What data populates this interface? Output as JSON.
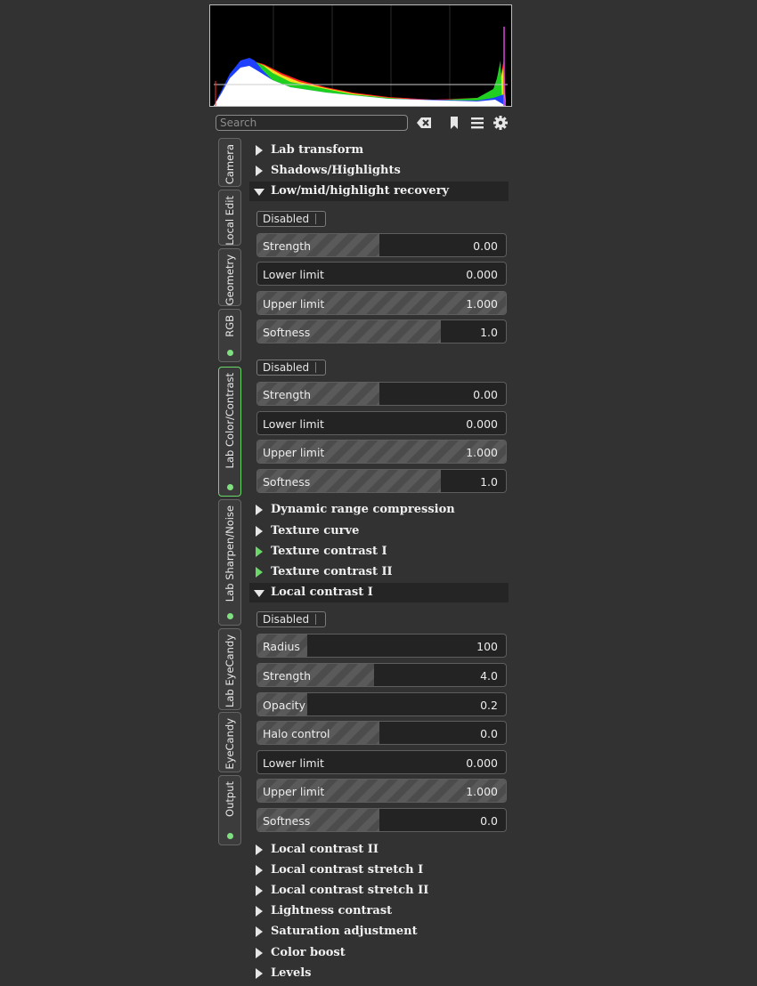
{
  "search": {
    "placeholder": "Search"
  },
  "toolbar_icons": [
    "clear-search-icon",
    "bookmark-icon",
    "hamburger-menu-icon",
    "gear-icon"
  ],
  "tabs": [
    {
      "label": "Camera",
      "active": false,
      "dot": false
    },
    {
      "label": "Local Edit",
      "active": false,
      "dot": false
    },
    {
      "label": "Geometry",
      "active": false,
      "dot": false
    },
    {
      "label": "RGB",
      "active": false,
      "dot": true
    },
    {
      "label": "Lab Color/Contrast",
      "active": true,
      "dot": true
    },
    {
      "label": "Lab Sharpen/Noise",
      "active": false,
      "dot": true
    },
    {
      "label": "Lab EyeCandy",
      "active": false,
      "dot": false
    },
    {
      "label": "EyeCandy",
      "active": false,
      "dot": false
    },
    {
      "label": "Output",
      "active": false,
      "dot": true
    }
  ],
  "tools": [
    {
      "title": "Lab transform",
      "state": "collapsed"
    },
    {
      "title": "Shadows/Highlights",
      "state": "collapsed"
    },
    {
      "title": "Low/mid/highlight recovery",
      "state": "expanded",
      "groups": [
        {
          "toggle": "Disabled",
          "sliders": [
            {
              "label": "Strength",
              "value": "0.00",
              "fill": 0.49
            },
            {
              "label": "Lower limit",
              "value": "0.000",
              "fill": 0.0
            },
            {
              "label": "Upper limit",
              "value": "1.000",
              "fill": 1.0
            },
            {
              "label": "Softness",
              "value": "1.0",
              "fill": 0.74
            }
          ]
        },
        {
          "toggle": "Disabled",
          "sliders": [
            {
              "label": "Strength",
              "value": "0.00",
              "fill": 0.49
            },
            {
              "label": "Lower limit",
              "value": "0.000",
              "fill": 0.0
            },
            {
              "label": "Upper limit",
              "value": "1.000",
              "fill": 1.0
            },
            {
              "label": "Softness",
              "value": "1.0",
              "fill": 0.74
            }
          ]
        }
      ]
    },
    {
      "title": "Dynamic range compression",
      "state": "collapsed"
    },
    {
      "title": "Texture curve",
      "state": "collapsed"
    },
    {
      "title": "Texture contrast I",
      "state": "collapsed-active"
    },
    {
      "title": "Texture contrast II",
      "state": "collapsed-active"
    },
    {
      "title": "Local contrast I",
      "state": "expanded",
      "groups": [
        {
          "toggle": "Disabled",
          "sliders": [
            {
              "label": "Radius",
              "value": "100",
              "fill": 0.2
            },
            {
              "label": "Strength",
              "value": "4.0",
              "fill": 0.47
            },
            {
              "label": "Opacity",
              "value": "0.2",
              "fill": 0.2
            },
            {
              "label": "Halo control",
              "value": "0.0",
              "fill": 0.49
            },
            {
              "label": "Lower limit",
              "value": "0.000",
              "fill": 0.0
            },
            {
              "label": "Upper limit",
              "value": "1.000",
              "fill": 1.0
            },
            {
              "label": "Softness",
              "value": "0.0",
              "fill": 0.49
            }
          ]
        }
      ]
    },
    {
      "title": "Local contrast II",
      "state": "collapsed"
    },
    {
      "title": "Local contrast stretch I",
      "state": "collapsed"
    },
    {
      "title": "Local contrast stretch II",
      "state": "collapsed"
    },
    {
      "title": "Lightness contrast",
      "state": "collapsed"
    },
    {
      "title": "Saturation adjustment",
      "state": "collapsed"
    },
    {
      "title": "Color boost",
      "state": "collapsed"
    },
    {
      "title": "Levels",
      "state": "collapsed"
    }
  ],
  "colors": {
    "accent": "#6ad96a",
    "panel_bg": "#323232",
    "header_bg": "#252525"
  }
}
